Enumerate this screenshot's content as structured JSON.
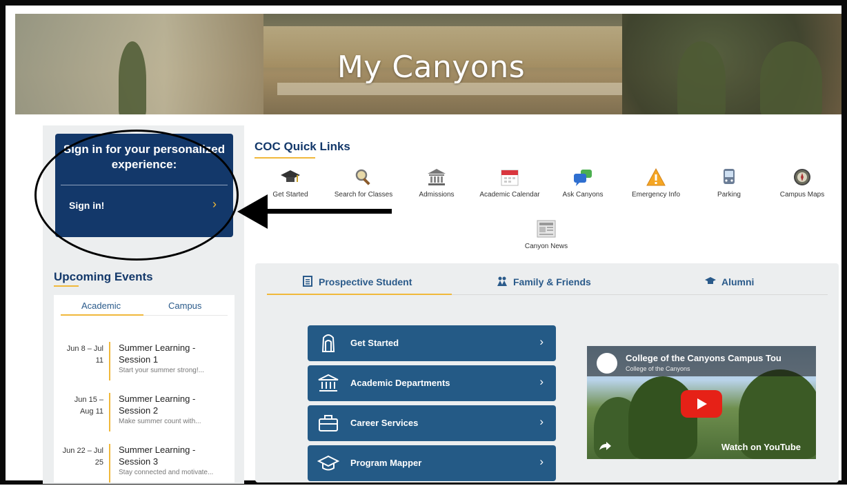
{
  "hero": {
    "title": "My Canyons"
  },
  "signin": {
    "heading": "Sign in for your personalized experience:",
    "link": "Sign in!",
    "chevron": "›"
  },
  "events": {
    "title": "Upcoming Events",
    "tabs": [
      "Academic",
      "Campus"
    ],
    "items": [
      {
        "date": "Jun 8 – Jul 11",
        "title": "Summer Learning - Session 1",
        "desc": "Start your summer strong!..."
      },
      {
        "date": "Jun 15 – Aug 11",
        "title": "Summer Learning - Session 2",
        "desc": "Make summer count with..."
      },
      {
        "date": "Jun 22 – Jul 25",
        "title": "Summer Learning - Session 3",
        "desc": "Stay connected and motivate..."
      }
    ]
  },
  "quicklinks": {
    "title": "COC Quick Links",
    "items": [
      {
        "label": "Get Started",
        "icon": "graduation-cap-icon"
      },
      {
        "label": "Search for Classes",
        "icon": "magnifier-icon"
      },
      {
        "label": "Admissions",
        "icon": "building-icon"
      },
      {
        "label": "Academic Calendar",
        "icon": "calendar-icon"
      },
      {
        "label": "Ask Canyons",
        "icon": "chat-bubbles-icon"
      },
      {
        "label": "Emergency Info",
        "icon": "warning-icon"
      },
      {
        "label": "Parking",
        "icon": "bus-icon"
      },
      {
        "label": "Campus Maps",
        "icon": "compass-icon"
      },
      {
        "label": "Canyon News",
        "icon": "newspaper-icon"
      }
    ]
  },
  "panel": {
    "tabs": [
      {
        "label": "Prospective Student",
        "icon": "document-icon"
      },
      {
        "label": "Family & Friends",
        "icon": "people-icon"
      },
      {
        "label": "Alumni",
        "icon": "graduation-cap-icon"
      }
    ],
    "buttons": [
      {
        "label": "Get Started",
        "icon": "backpack-icon"
      },
      {
        "label": "Academic Departments",
        "icon": "building-icon"
      },
      {
        "label": "Career Services",
        "icon": "briefcase-icon"
      },
      {
        "label": "Program Mapper",
        "icon": "graduation-cap-icon"
      }
    ],
    "video": {
      "title": "College of the Canyons Campus Tou",
      "channel": "College of the Canyons",
      "watch": "Watch on YouTube"
    }
  },
  "colors": {
    "navy": "#13386a",
    "gold": "#f0b83a",
    "button": "#245a86"
  }
}
